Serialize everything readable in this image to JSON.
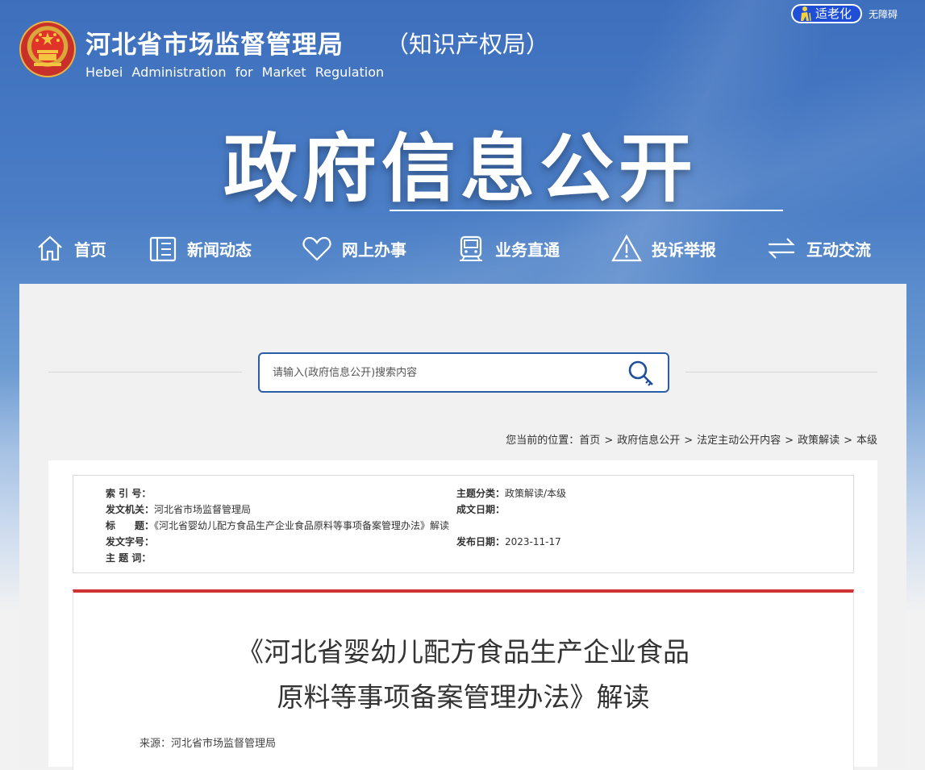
{
  "header": {
    "site_title": "河北省市场监督管理局",
    "site_title_suffix": "（知识产权局）",
    "site_subtitle": "Hebei Administration for Market Regulation",
    "elder_mode": "适老化",
    "accessibility": "无障碍",
    "section_title": "政府信息公开"
  },
  "nav": {
    "items": [
      {
        "label": "首页",
        "icon": "home-icon"
      },
      {
        "label": "新闻动态",
        "icon": "news-icon"
      },
      {
        "label": "网上办事",
        "icon": "heart-icon"
      },
      {
        "label": "业务直通",
        "icon": "train-icon"
      },
      {
        "label": "投诉举报",
        "icon": "warning-icon"
      },
      {
        "label": "互动交流",
        "icon": "exchange-icon"
      }
    ]
  },
  "search": {
    "placeholder": "请输入(政府信息公开)搜索内容",
    "icon": "search-icon"
  },
  "breadcrumb": {
    "prefix": "您当前的位置：",
    "items": [
      "首页",
      "政府信息公开",
      "法定主动公开内容",
      "政策解读",
      "本级"
    ],
    "separator": ">"
  },
  "meta": {
    "index_label": "索 引 号：",
    "index_value": "",
    "topic_label": "主题分类：",
    "topic_value": "政策解读/本级",
    "issuer_label": "发文机关：",
    "issuer_value": "河北省市场监督管理局",
    "created_label": "成文日期：",
    "created_value": "",
    "title_label": "标　　题：",
    "title_value": "《河北省婴幼儿配方食品生产企业食品原料等事项备案管理办法》解读",
    "docno_label": "发文字号：",
    "docno_value": "",
    "published_label": "发布日期：",
    "published_value": "2023-11-17",
    "keywords_label": "主 题 词：",
    "keywords_value": ""
  },
  "article": {
    "title_line1": "《河北省婴幼儿配方食品生产企业食品",
    "title_line2": "原料等事项备案管理办法》解读",
    "source": "来源：河北省市场监督管理局"
  },
  "colors": {
    "banner_blue": "#3d6fbd",
    "accent_red": "#d03336",
    "search_border": "#2a5da8",
    "elder_button": "#1e4fd6"
  }
}
